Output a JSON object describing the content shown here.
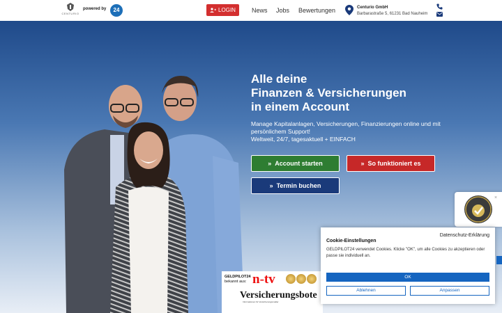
{
  "header": {
    "logo_text": "CENTURIO",
    "powered_by": "powered by",
    "badge": "24",
    "login": "LOGIN",
    "nav": [
      "News",
      "Jobs",
      "Bewertungen"
    ],
    "company_name": "Centurio GmbH",
    "company_address": "Barbarastraße 5, 61231 Bad Nauheim"
  },
  "hero": {
    "headline": [
      "Alle deine",
      "Finanzen & Versicherungen",
      "in einem Account"
    ],
    "subline": [
      "Manage Kapitalanlagen, Versicherungen, Finanzierungen online und mit persönlichem Support!",
      "Weltweit, 24/7, tagesaktuell + EINFACH"
    ],
    "buttons": {
      "account": "Account starten",
      "how": "So funktioniert es",
      "appointment": "Termin buchen"
    }
  },
  "press": {
    "label": [
      "GELDPILOT24",
      "bekannt aus:"
    ],
    "ntv": "n-tv",
    "vb": "Versicherungsbote",
    "vb_sub": "Informationen für Versicherungsmakler"
  },
  "cookie": {
    "privacy": "Datenschutz-Erklärung",
    "title": "Cookie-Einstellungen",
    "text": "GELDPILOT24 verwendet Cookies. Klicke \"OK\", um alle Cookies zu akzeptieren oder passe sie individuell an.",
    "ok": "OK",
    "decline": "Ablehnen",
    "customize": "Anpassen"
  },
  "colors": {
    "accent_red": "#d32f2f",
    "green": "#2e7d32",
    "navy": "#1a3a7a",
    "link_blue": "#1565c0"
  },
  "icons": {
    "login": "user-plus-icon",
    "location": "map-pin-icon",
    "phone": "phone-icon",
    "mail": "mail-icon",
    "cta": "double-chevron-right-icon"
  }
}
